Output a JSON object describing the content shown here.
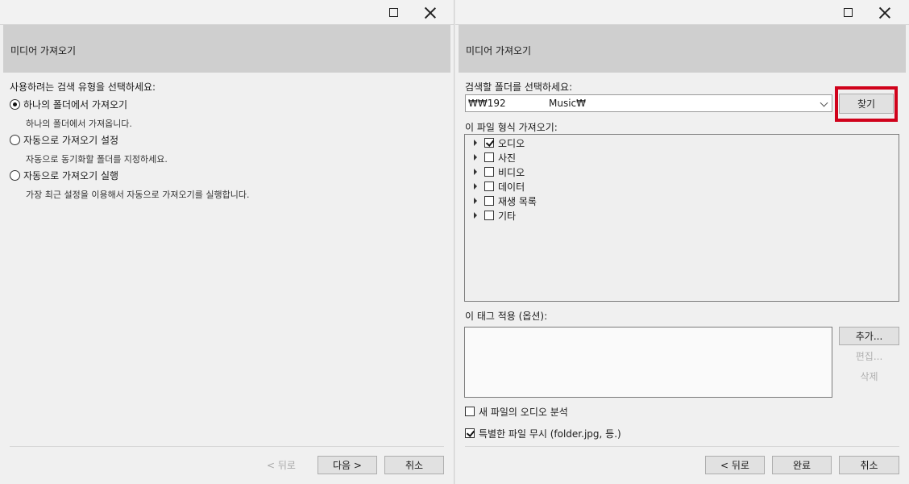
{
  "left": {
    "header_title": "미디어 가져오기",
    "prompt": "사용하려는 검색 유형을 선택하세요:",
    "options": [
      {
        "label": "하나의 폴더에서 가져오기",
        "desc": "하나의 폴더에서 가져옵니다.",
        "selected": true
      },
      {
        "label": "자동으로 가져오기 설정",
        "desc": "자동으로 동기화할 폴더를 지정하세요.",
        "selected": false
      },
      {
        "label": "자동으로 가져오기 실행",
        "desc": "가장 최근 설정을 이용해서 자동으로 가져오기를 실행합니다.",
        "selected": false
      }
    ],
    "buttons": {
      "back": "< 뒤로",
      "next": "다음 >",
      "cancel": "취소"
    }
  },
  "right": {
    "header_title": "미디어 가져오기",
    "folder_prompt": "검색할 폴더를 선택하세요:",
    "folder_path_start": "₩₩192",
    "folder_path_end": "Music₩",
    "browse_label": "찾기",
    "file_types_label": "이 파일 형식 가져오기:",
    "file_types": [
      {
        "label": "오디오",
        "checked": true
      },
      {
        "label": "사진",
        "checked": false
      },
      {
        "label": "비디오",
        "checked": false
      },
      {
        "label": "데이터",
        "checked": false
      },
      {
        "label": "재생 목록",
        "checked": false
      },
      {
        "label": "기타",
        "checked": false
      }
    ],
    "tags_label": "이 태그 적용 (옵션):",
    "tag_buttons": {
      "add": "추가...",
      "edit": "편집...",
      "delete": "삭제"
    },
    "analyze_audio_label": "새 파일의 오디오 분석",
    "analyze_audio_checked": false,
    "ignore_special_label": "특별한 파일 무시 (folder.jpg, 등.)",
    "ignore_special_checked": true,
    "buttons": {
      "back": "< 뒤로",
      "finish": "완료",
      "cancel": "취소"
    }
  },
  "colors": {
    "highlight": "#d0021b",
    "header_band": "#cfcfcf",
    "window_bg": "#f0f0f0"
  }
}
